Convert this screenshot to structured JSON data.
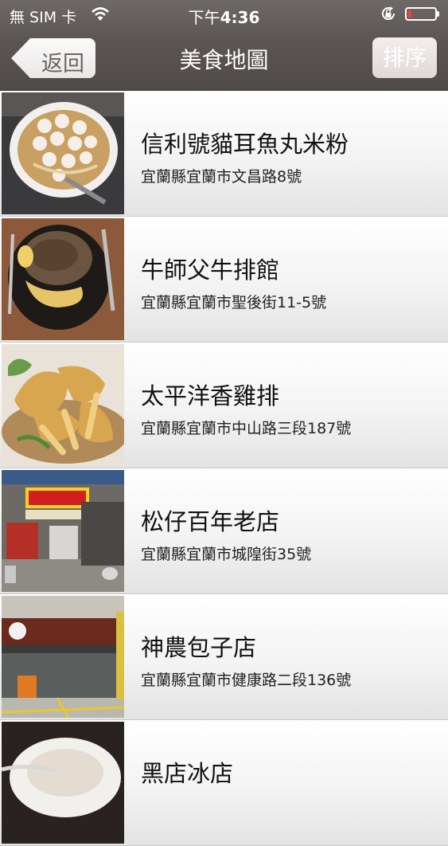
{
  "status_bar": {
    "carrier": "無 SIM 卡",
    "time_prefix": "下午",
    "time_value": "4:36",
    "battery_percent": 12,
    "battery_color": "#ff3b30"
  },
  "nav_bar": {
    "back_label": "返回",
    "title": "美食地圖",
    "sort_label": "排序"
  },
  "restaurants": [
    {
      "name": "信利號貓耳魚丸米粉",
      "address": "宜蘭縣宜蘭市文昌路8號",
      "photo": "fishball-noodle-soup"
    },
    {
      "name": "牛師父牛排館",
      "address": "宜蘭縣宜蘭市聖後街11-5號",
      "photo": "sizzling-steak"
    },
    {
      "name": "太平洋香雞排",
      "address": "宜蘭縣宜蘭市中山路三段187號",
      "photo": "fried-chicken"
    },
    {
      "name": "松仔百年老店",
      "address": "宜蘭縣宜蘭市城隍街35號",
      "photo": "old-shopfront"
    },
    {
      "name": "神農包子店",
      "address": "宜蘭縣宜蘭市健康路二段136號",
      "photo": "bun-shop-storefront"
    },
    {
      "name": "黑店冰店",
      "address": "",
      "photo": "shaved-ice-bowl"
    }
  ]
}
